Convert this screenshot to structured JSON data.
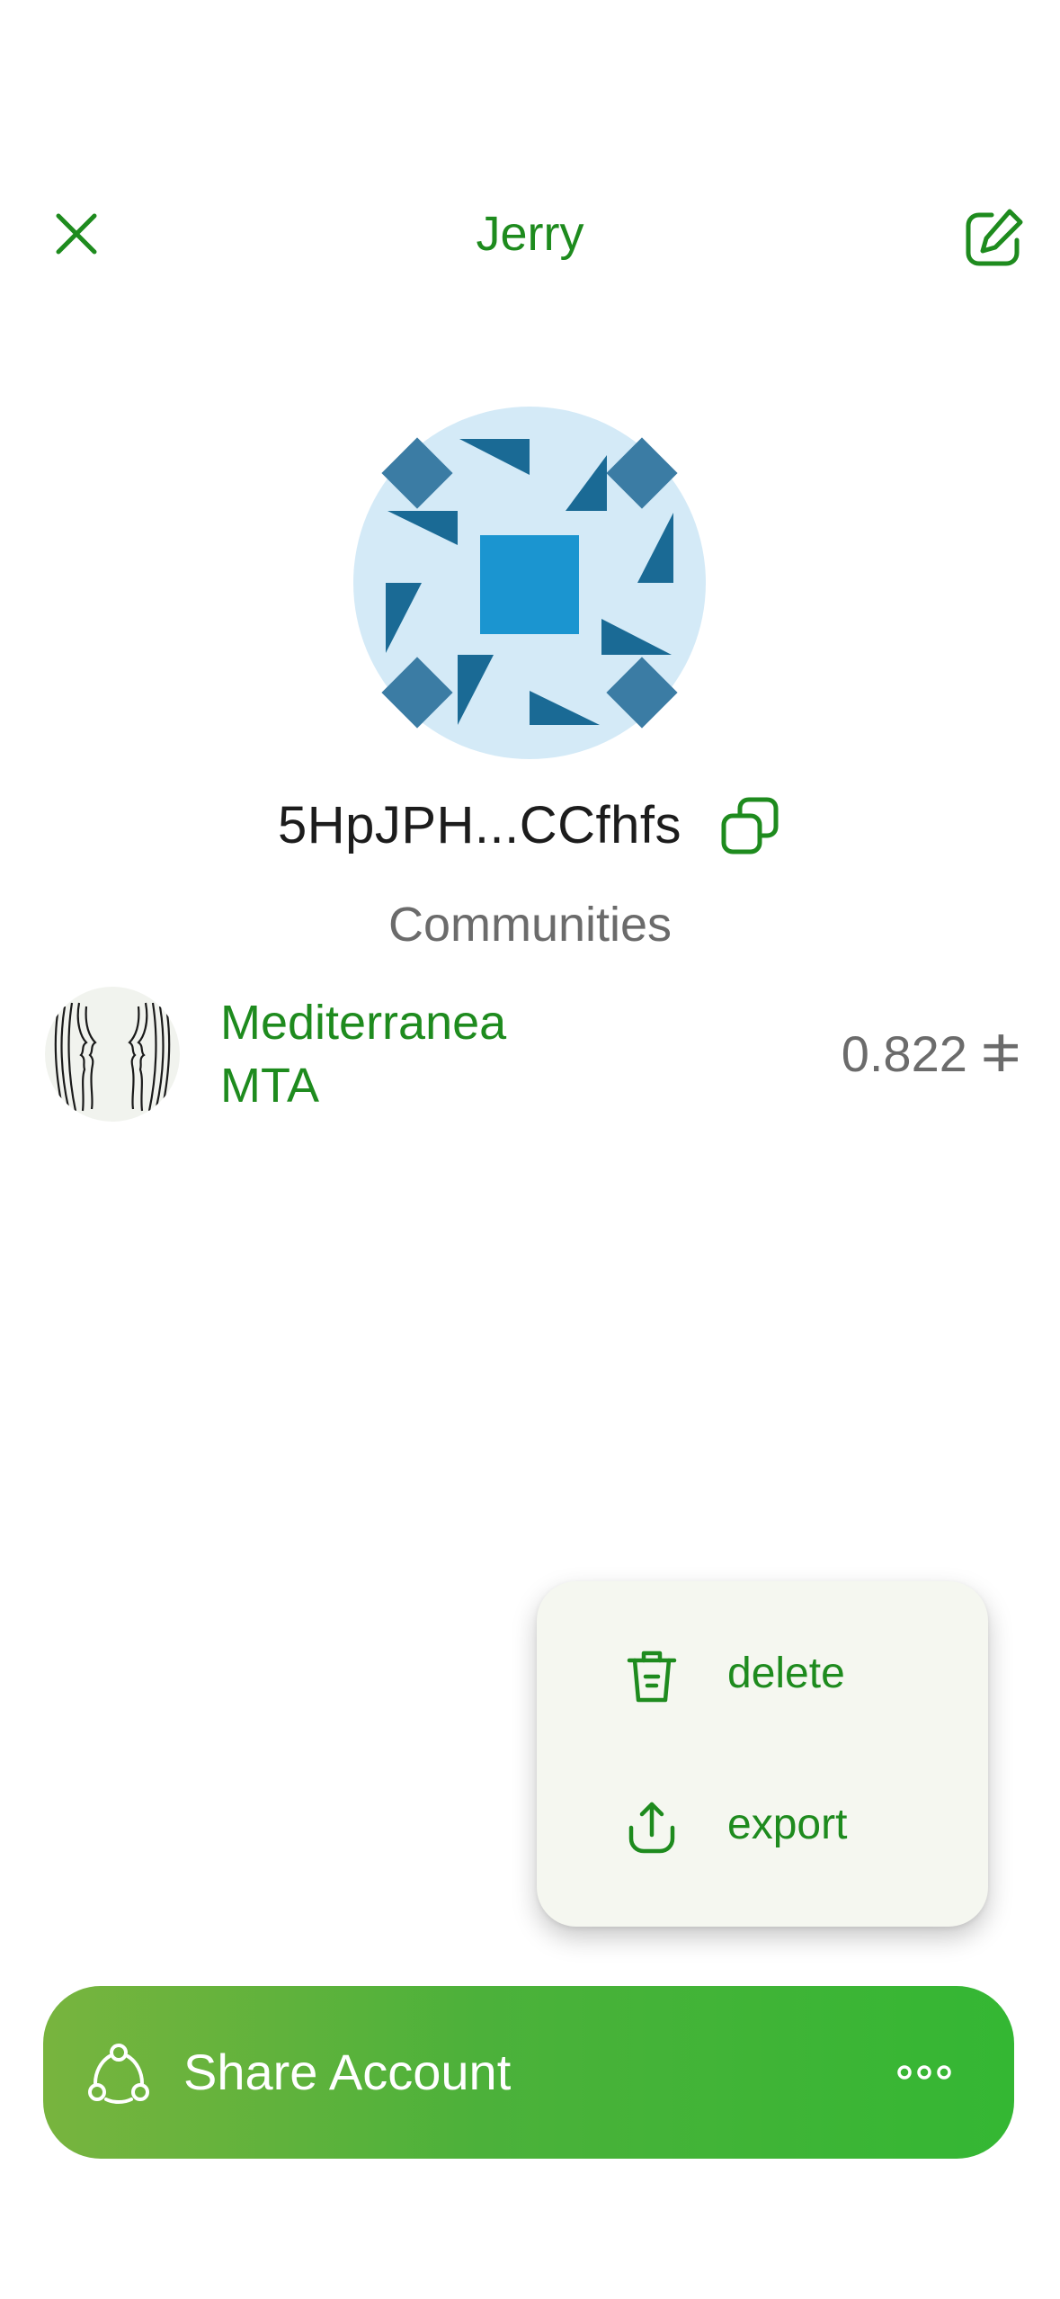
{
  "header": {
    "title": "Jerry",
    "close_icon": "close-icon",
    "edit_icon": "edit-icon"
  },
  "account": {
    "address": "5HpJPH...CCfhfs",
    "copy_icon": "copy-icon",
    "avatar_icon": "identicon"
  },
  "communities": {
    "label": "Communities",
    "items": [
      {
        "name": "Mediterranea",
        "symbol": "MTA",
        "balance": "0.822 ⵐ"
      }
    ]
  },
  "menu": {
    "items": [
      {
        "label": "delete",
        "icon": "trash-icon"
      },
      {
        "label": "export",
        "icon": "upload-icon"
      }
    ]
  },
  "share_bar": {
    "label": "Share Account",
    "icon": "share-icon",
    "more_icon": "more-icon"
  },
  "colors": {
    "accent_green": "#1e8b1e",
    "bar_gradient_start": "#78b43e",
    "bar_gradient_end": "#34b733",
    "menu_background": "#f5f7f0",
    "identicon_background": "#d4eaf7",
    "identicon_dark": "#1a6a95",
    "identicon_mid": "#3b7ca4",
    "identicon_center": "#1b95d0"
  }
}
